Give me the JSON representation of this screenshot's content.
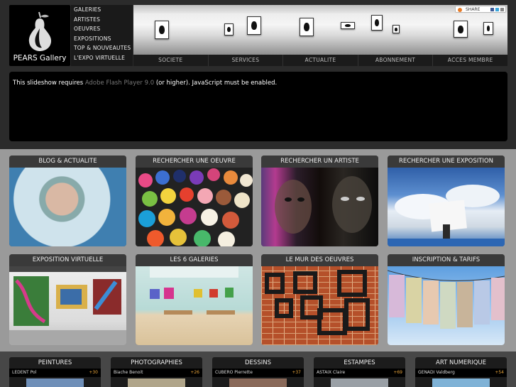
{
  "brand": {
    "name": "PEARS Gallery"
  },
  "nav_menu": [
    "GALERIES",
    "ARTISTES",
    "OEUVRES",
    "EXPOSITIONS",
    "TOP & NOUVEAUTES",
    "L'EXPO VIRTUELLE"
  ],
  "share": {
    "label": "SHARE"
  },
  "tabs": [
    "SOCIETE",
    "SERVICES",
    "ACTUALITE",
    "ABONNEMENT",
    "ACCES MEMBRE"
  ],
  "slideshow": {
    "before": "This slideshow requires ",
    "link": "Adobe Flash Player 9.0",
    "after": " (or higher). JavaScript must be enabled."
  },
  "tiles": [
    {
      "title": "BLOG & ACTUALITE"
    },
    {
      "title": "RECHERCHER UNE OEUVRE"
    },
    {
      "title": "RECHERCHER UN ARTISTE"
    },
    {
      "title": "RECHERCHER UNE EXPOSITION"
    },
    {
      "title": "EXPOSITION VIRTUELLE"
    },
    {
      "title": "LES 6 GALERIES"
    },
    {
      "title": "LE MUR DES OEUVRES"
    },
    {
      "title": "INSCRIPTION & TARIFS"
    }
  ],
  "categories": [
    {
      "title": "PEINTURES",
      "artist": "LEDENT Pol",
      "count": "+30"
    },
    {
      "title": "PHOTOGRAPHIES",
      "artist": "Biache Benoit",
      "count": "+26"
    },
    {
      "title": "DESSINS",
      "artist": "CUBERO Pierrette",
      "count": "+37"
    },
    {
      "title": "ESTAMPES",
      "artist": "ASTAIX Claire",
      "count": "+69"
    },
    {
      "title": "ART NUMERIQUE",
      "artist": "GENADI Valdberg",
      "count": "+54"
    }
  ]
}
